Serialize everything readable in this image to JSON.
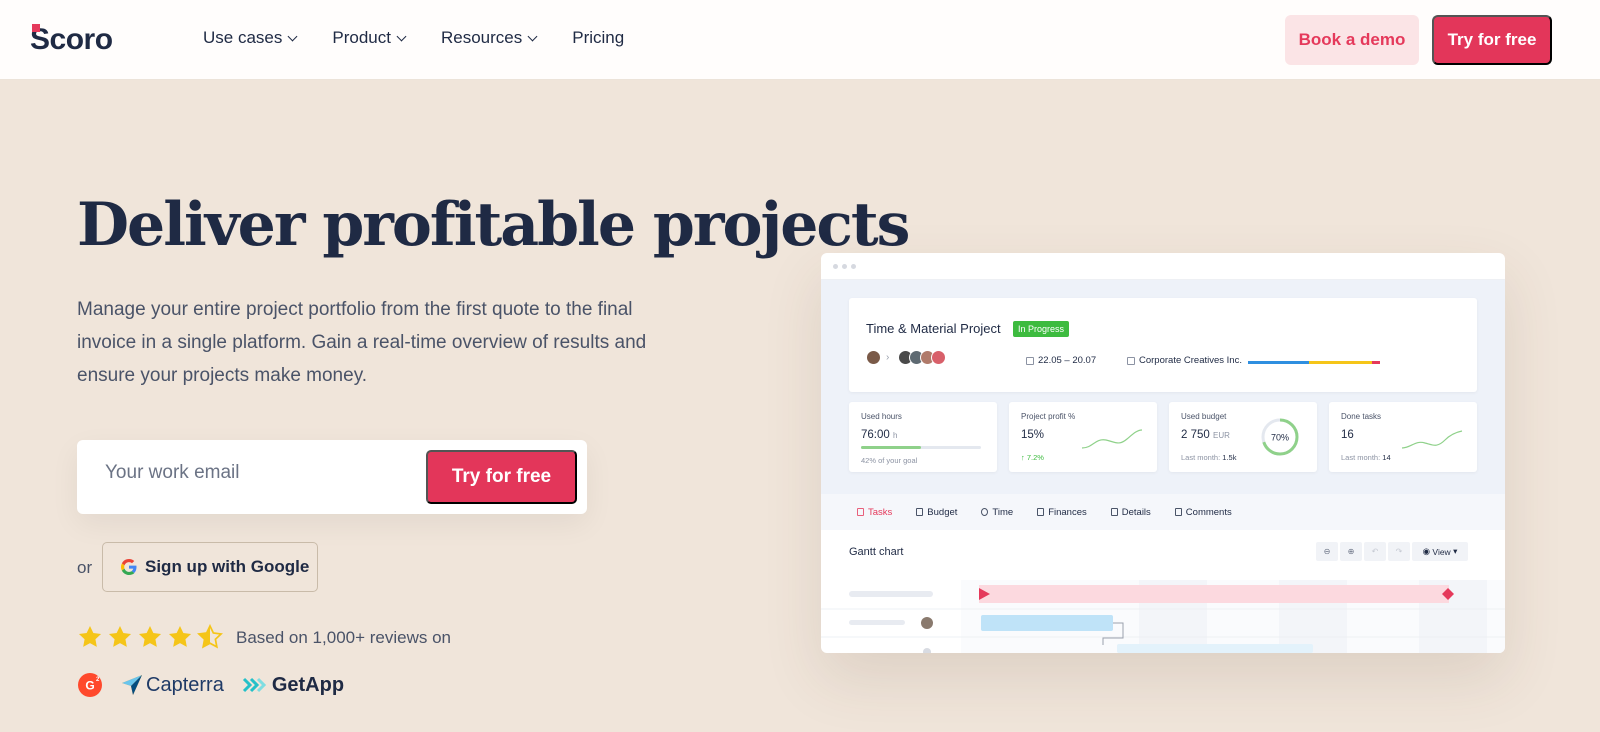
{
  "nav": {
    "logo": "Scoro",
    "items": [
      {
        "label": "Use cases",
        "has_dropdown": true
      },
      {
        "label": "Product",
        "has_dropdown": true
      },
      {
        "label": "Resources",
        "has_dropdown": true
      },
      {
        "label": "Pricing",
        "has_dropdown": false
      }
    ],
    "book_demo": "Book a demo",
    "try_free": "Try for free"
  },
  "hero": {
    "title": "Deliver profitable projects",
    "subtitle": "Manage your entire project portfolio from the first quote to the final invoice in a single platform. Gain a real-time overview of results and ensure your projects make money.",
    "email_placeholder": "Your work email",
    "try_free": "Try for free",
    "or": "or",
    "google_signup": "Sign up with Google",
    "rating_stars": 4.5,
    "reviews_text": "Based on 1,000+ reviews on",
    "review_sites": [
      "G2",
      "Capterra",
      "GetApp"
    ]
  },
  "mockup": {
    "project_title": "Time & Material Project",
    "status_badge": "In Progress",
    "dates": "22.05 – 20.07",
    "client": "Corporate Creatives Inc.",
    "stats": {
      "used_hours": {
        "label": "Used hours",
        "value": "76:00",
        "unit": "h",
        "foot": "42% of your goal",
        "fill_fraction": 0.5
      },
      "profit": {
        "label": "Project profit %",
        "value": "15%",
        "foot": "7.2%"
      },
      "budget": {
        "label": "Used budget",
        "value": "2 750",
        "unit": "EUR",
        "foot_label": "Last month:",
        "foot_value": "1.5k",
        "percent_label": "70%",
        "percent": 70
      },
      "done_tasks": {
        "label": "Done tasks",
        "value": "16",
        "foot_label": "Last month:",
        "foot_value": "14"
      }
    },
    "tabs": [
      "Tasks",
      "Budget",
      "Time",
      "Finances",
      "Details",
      "Comments"
    ],
    "active_tab": "Tasks",
    "gantt_title": "Gantt chart",
    "view_label": "View"
  },
  "colors": {
    "accent": "#e3365a",
    "accent_soft": "#fbe4e6",
    "hero_bg": "#f0e5da",
    "text_dark": "#1f2a44",
    "status_green": "#3dbb3f",
    "star_yellow": "#f5c518"
  }
}
